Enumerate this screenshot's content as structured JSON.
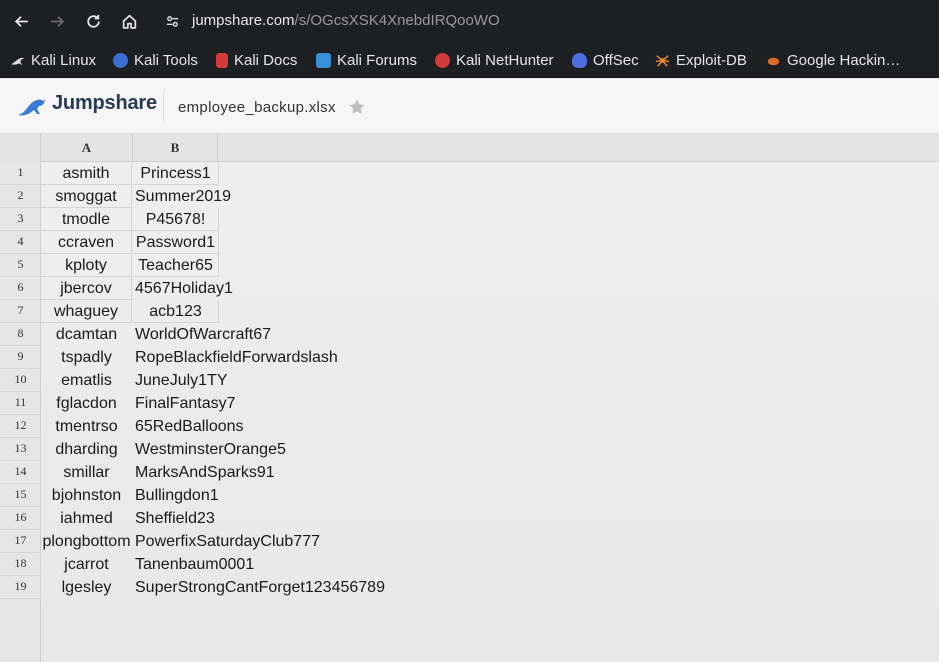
{
  "browser": {
    "url_host": "jumpshare.com",
    "url_path": "/s/OGcsXSK4XnebdIRQooWO",
    "bookmarks": [
      {
        "label": "Kali Linux",
        "icon": "kali-dragon-icon",
        "color": "#dddddd"
      },
      {
        "label": "Kali Tools",
        "icon": "kali-tools-icon",
        "color": "#3b6fd4"
      },
      {
        "label": "Kali Docs",
        "icon": "kali-docs-icon",
        "color": "#d33a3a"
      },
      {
        "label": "Kali Forums",
        "icon": "kali-forums-icon",
        "color": "#3b8fd4"
      },
      {
        "label": "Kali NetHunter",
        "icon": "nethunter-icon",
        "color": "#d33a3a"
      },
      {
        "label": "OffSec",
        "icon": "offsec-icon",
        "color": "#4b6fe0"
      },
      {
        "label": "Exploit-DB",
        "icon": "exploit-db-icon",
        "color": "#e08a2a"
      },
      {
        "label": "Google Hackin…",
        "icon": "ghdb-icon",
        "color": "#e06a2a"
      }
    ]
  },
  "app": {
    "logo_text": "Jumpshare",
    "file_name": "employee_backup.xlsx"
  },
  "sheet": {
    "columns": [
      "A",
      "B"
    ],
    "rows": [
      {
        "num": "1",
        "a": "asmith",
        "b": "Princess1"
      },
      {
        "num": "2",
        "a": "smoggat",
        "b": "Summer2019"
      },
      {
        "num": "3",
        "a": "tmodle",
        "b": "P45678!"
      },
      {
        "num": "4",
        "a": "ccraven",
        "b": "Password1"
      },
      {
        "num": "5",
        "a": "kploty",
        "b": "Teacher65"
      },
      {
        "num": "6",
        "a": "jbercov",
        "b": "4567Holiday1"
      },
      {
        "num": "7",
        "a": "whaguey",
        "b": "acb123"
      },
      {
        "num": "8",
        "a": "dcamtan",
        "b": "WorldOfWarcraft67"
      },
      {
        "num": "9",
        "a": "tspadly",
        "b": "RopeBlackfieldForwardslash"
      },
      {
        "num": "10",
        "a": "ematlis",
        "b": "JuneJuly1TY"
      },
      {
        "num": "11",
        "a": "fglacdon",
        "b": "FinalFantasy7"
      },
      {
        "num": "12",
        "a": "tmentrso",
        "b": "65RedBalloons"
      },
      {
        "num": "13",
        "a": "dharding",
        "b": "WestminsterOrange5"
      },
      {
        "num": "14",
        "a": "smillar",
        "b": "MarksAndSparks91"
      },
      {
        "num": "15",
        "a": "bjohnston",
        "b": "Bullingdon1"
      },
      {
        "num": "16",
        "a": "iahmed",
        "b": "Sheffield23"
      },
      {
        "num": "17",
        "a": "plongbottom",
        "b": "PowerfixSaturdayClub777"
      },
      {
        "num": "18",
        "a": "jcarrot",
        "b": "Tanenbaum0001"
      },
      {
        "num": "19",
        "a": "lgesley",
        "b": "SuperStrongCantForget123456789"
      }
    ]
  }
}
